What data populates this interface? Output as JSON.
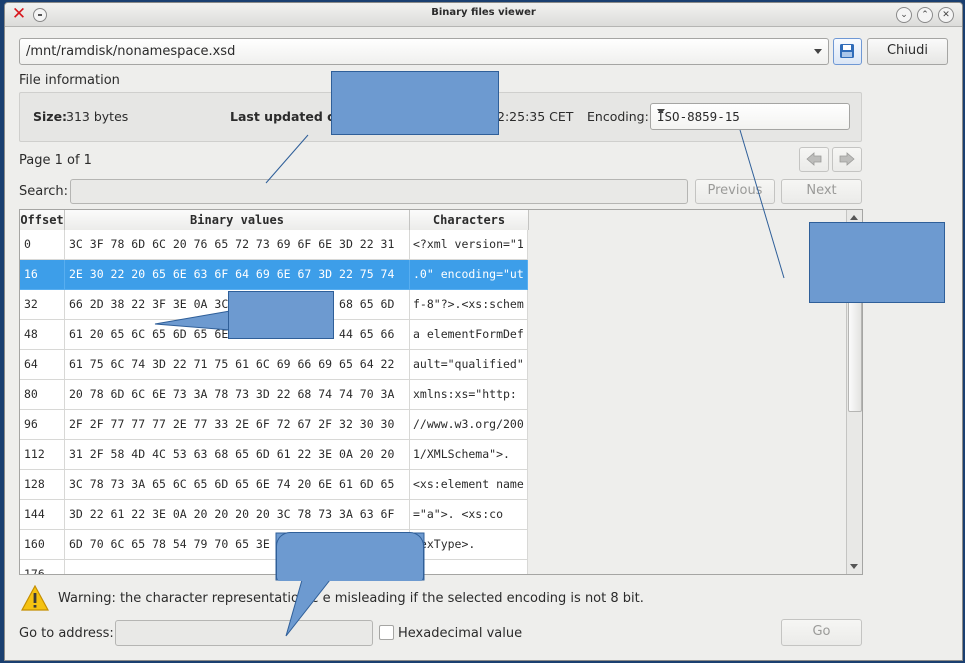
{
  "window": {
    "title": "Binary files viewer"
  },
  "file": {
    "path": "/mnt/ramdisk/nonamespace.xsd"
  },
  "buttons": {
    "close_label": "Chiudi",
    "previous_label": "Previous",
    "next_label": "Next",
    "go_label": "Go"
  },
  "info": {
    "section_title": "File information",
    "size_label": "Size:",
    "size_value": "313 bytes",
    "updated_label": "Last updated on:",
    "updated_value_visible": "2:25:35 CET",
    "encoding_label": "Encoding:",
    "encoding_value": "ISO-8859-15"
  },
  "paging": {
    "page_label": "Page 1 of 1"
  },
  "search": {
    "label": "Search:",
    "value": ""
  },
  "table": {
    "headers": [
      "Offset",
      "Binary values",
      "Characters"
    ],
    "selected_row": 1,
    "rows": [
      {
        "offset": "0",
        "binary": "3C 3F 78 6D 6C 20 76 65 72 73 69 6F 6E 3D 22 31",
        "chars": "<?xml version=\"1"
      },
      {
        "offset": "16",
        "binary": "2E 30 22 20 65 6E 63 6F 64 69 6E 67 3D 22 75 74",
        "chars": ".0\" encoding=\"ut"
      },
      {
        "offset": "32",
        "binary": "66 2D 38 22 3F 3E 0A 3C 78 73 3A 73 63 68 65 6D",
        "chars": "f-8\"?>.<xs:schem"
      },
      {
        "offset": "48",
        "binary": "61 20 65 6C 65 6D 65 6E 74 46 6F 72 6D 44 65 66",
        "chars": "a elementFormDef"
      },
      {
        "offset": "64",
        "binary": "61 75 6C 74 3D 22 71 75 61 6C 69 66 69 65 64 22",
        "chars": "ault=\"qualified\""
      },
      {
        "offset": "80",
        "binary": "20 78 6D 6C 6E 73 3A 78 73 3D 22 68 74 74 70 3A",
        "chars": " xmlns:xs=\"http:"
      },
      {
        "offset": "96",
        "binary": "2F 2F 77 77 77 2E 77 33 2E 6F 72 67 2F 32 30 30",
        "chars": "//www.w3.org/200"
      },
      {
        "offset": "112",
        "binary": "31 2F 58 4D 4C 53 63 68 65 6D 61 22 3E 0A 20 20",
        "chars": "1/XMLSchema\">."
      },
      {
        "offset": "128",
        "binary": "3C 78 73 3A 65 6C 65 6D 65 6E 74 20 6E 61 6D 65",
        "chars": "<xs:element name"
      },
      {
        "offset": "144",
        "binary": "3D 22 61 22 3E 0A 20 20 20 20 3C 78 73 3A 63 6F",
        "chars": "=\"a\">.    <xs:co"
      },
      {
        "offset": "160",
        "binary": "6D 70 6C 65 78 54 79 70 65 3E",
        "chars": "lexType>."
      },
      {
        "offset": "176",
        "binary": "",
        "chars": ""
      }
    ]
  },
  "warning": {
    "text": "Warning: the character representation c       e misleading if the selected encoding is not 8 bit."
  },
  "goto": {
    "label": "Go to address:",
    "value": "",
    "hex_label": "Hexadecimal value"
  },
  "colors": {
    "selection": "#3d9ee9",
    "annotation_fill": "#6d9ad0",
    "annotation_border": "#2f5f99"
  }
}
